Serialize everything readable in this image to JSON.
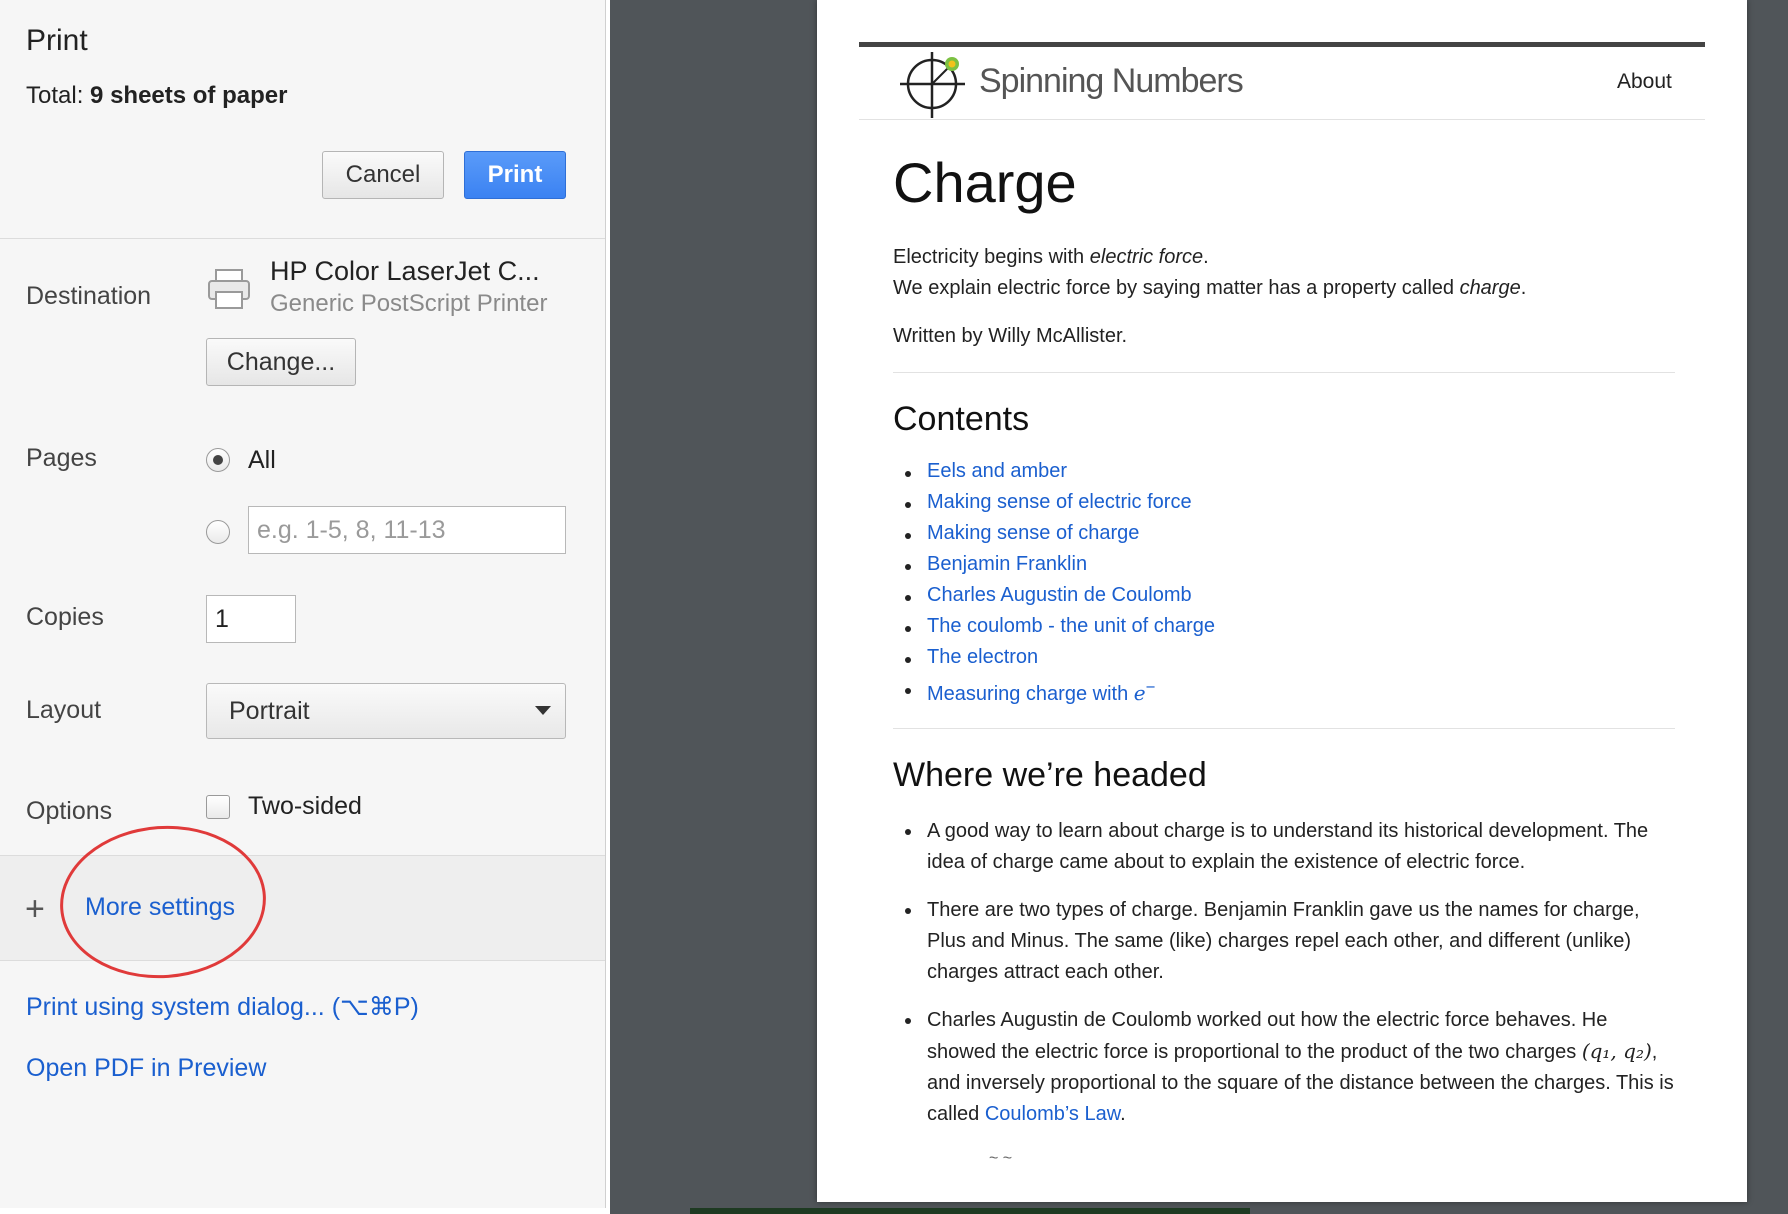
{
  "panel": {
    "title": "Print",
    "total_label": "Total:",
    "total_value": "9 sheets of paper",
    "cancel_label": "Cancel",
    "print_label": "Print",
    "destination": {
      "label": "Destination",
      "printer_name": "HP Color LaserJet C...",
      "printer_type": "Generic PostScript Printer",
      "change_label": "Change..."
    },
    "pages": {
      "label": "Pages",
      "all_label": "All",
      "range_placeholder": "e.g. 1-5, 8, 11-13",
      "selected": "All"
    },
    "copies": {
      "label": "Copies",
      "value": "1"
    },
    "layout": {
      "label": "Layout",
      "value": "Portrait"
    },
    "options": {
      "label": "Options",
      "two_sided_label": "Two-sided",
      "two_sided_checked": false
    },
    "more_settings": "More settings",
    "system_dialog_link": "Print using system dialog... (⌥⌘P)",
    "open_pdf_link": "Open PDF in Preview",
    "annotation_color": "#e03a3a"
  },
  "preview": {
    "site_name": "Spinning Numbers",
    "nav_about": "About",
    "title": "Charge",
    "intro_1_pre": "Electricity begins with ",
    "intro_1_em": "electric force",
    "intro_1_post": ".",
    "intro_2_pre": "We explain electric force by saying matter has a property called ",
    "intro_2_em": "charge",
    "intro_2_post": ".",
    "author": "Written by Willy McAllister.",
    "contents_heading": "Contents",
    "contents": [
      "Eels and amber",
      "Making sense of electric force",
      "Making sense of charge",
      "Benjamin Franklin",
      "Charles Augustin de Coulomb",
      "The coulomb - the unit of charge",
      "The electron",
      "Measuring charge with "
    ],
    "contents_math": "e",
    "contents_math_sup": "−",
    "headed_heading": "Where we’re headed",
    "bullets": {
      "b1": "A good way to learn about charge is to understand its historical development. The idea of charge came about to explain the existence of electric force.",
      "b2": "There are two types of charge. Benjamin Franklin gave us the names for charge, Plus and Minus. The same (like) charges repel each other, and different (unlike) charges attract each other.",
      "b3_pre": "Charles Augustin de Coulomb worked out how the electric force behaves. He showed the electric force is proportional to the product of the two charges ",
      "b3_math": "(q₁, q₂)",
      "b3_mid": ", and inversely proportional to the square of the distance between the charges. This is called ",
      "b3_link": "Coulomb’s Law",
      "b3_post": "."
    },
    "link_color": "#1a5fcf"
  }
}
